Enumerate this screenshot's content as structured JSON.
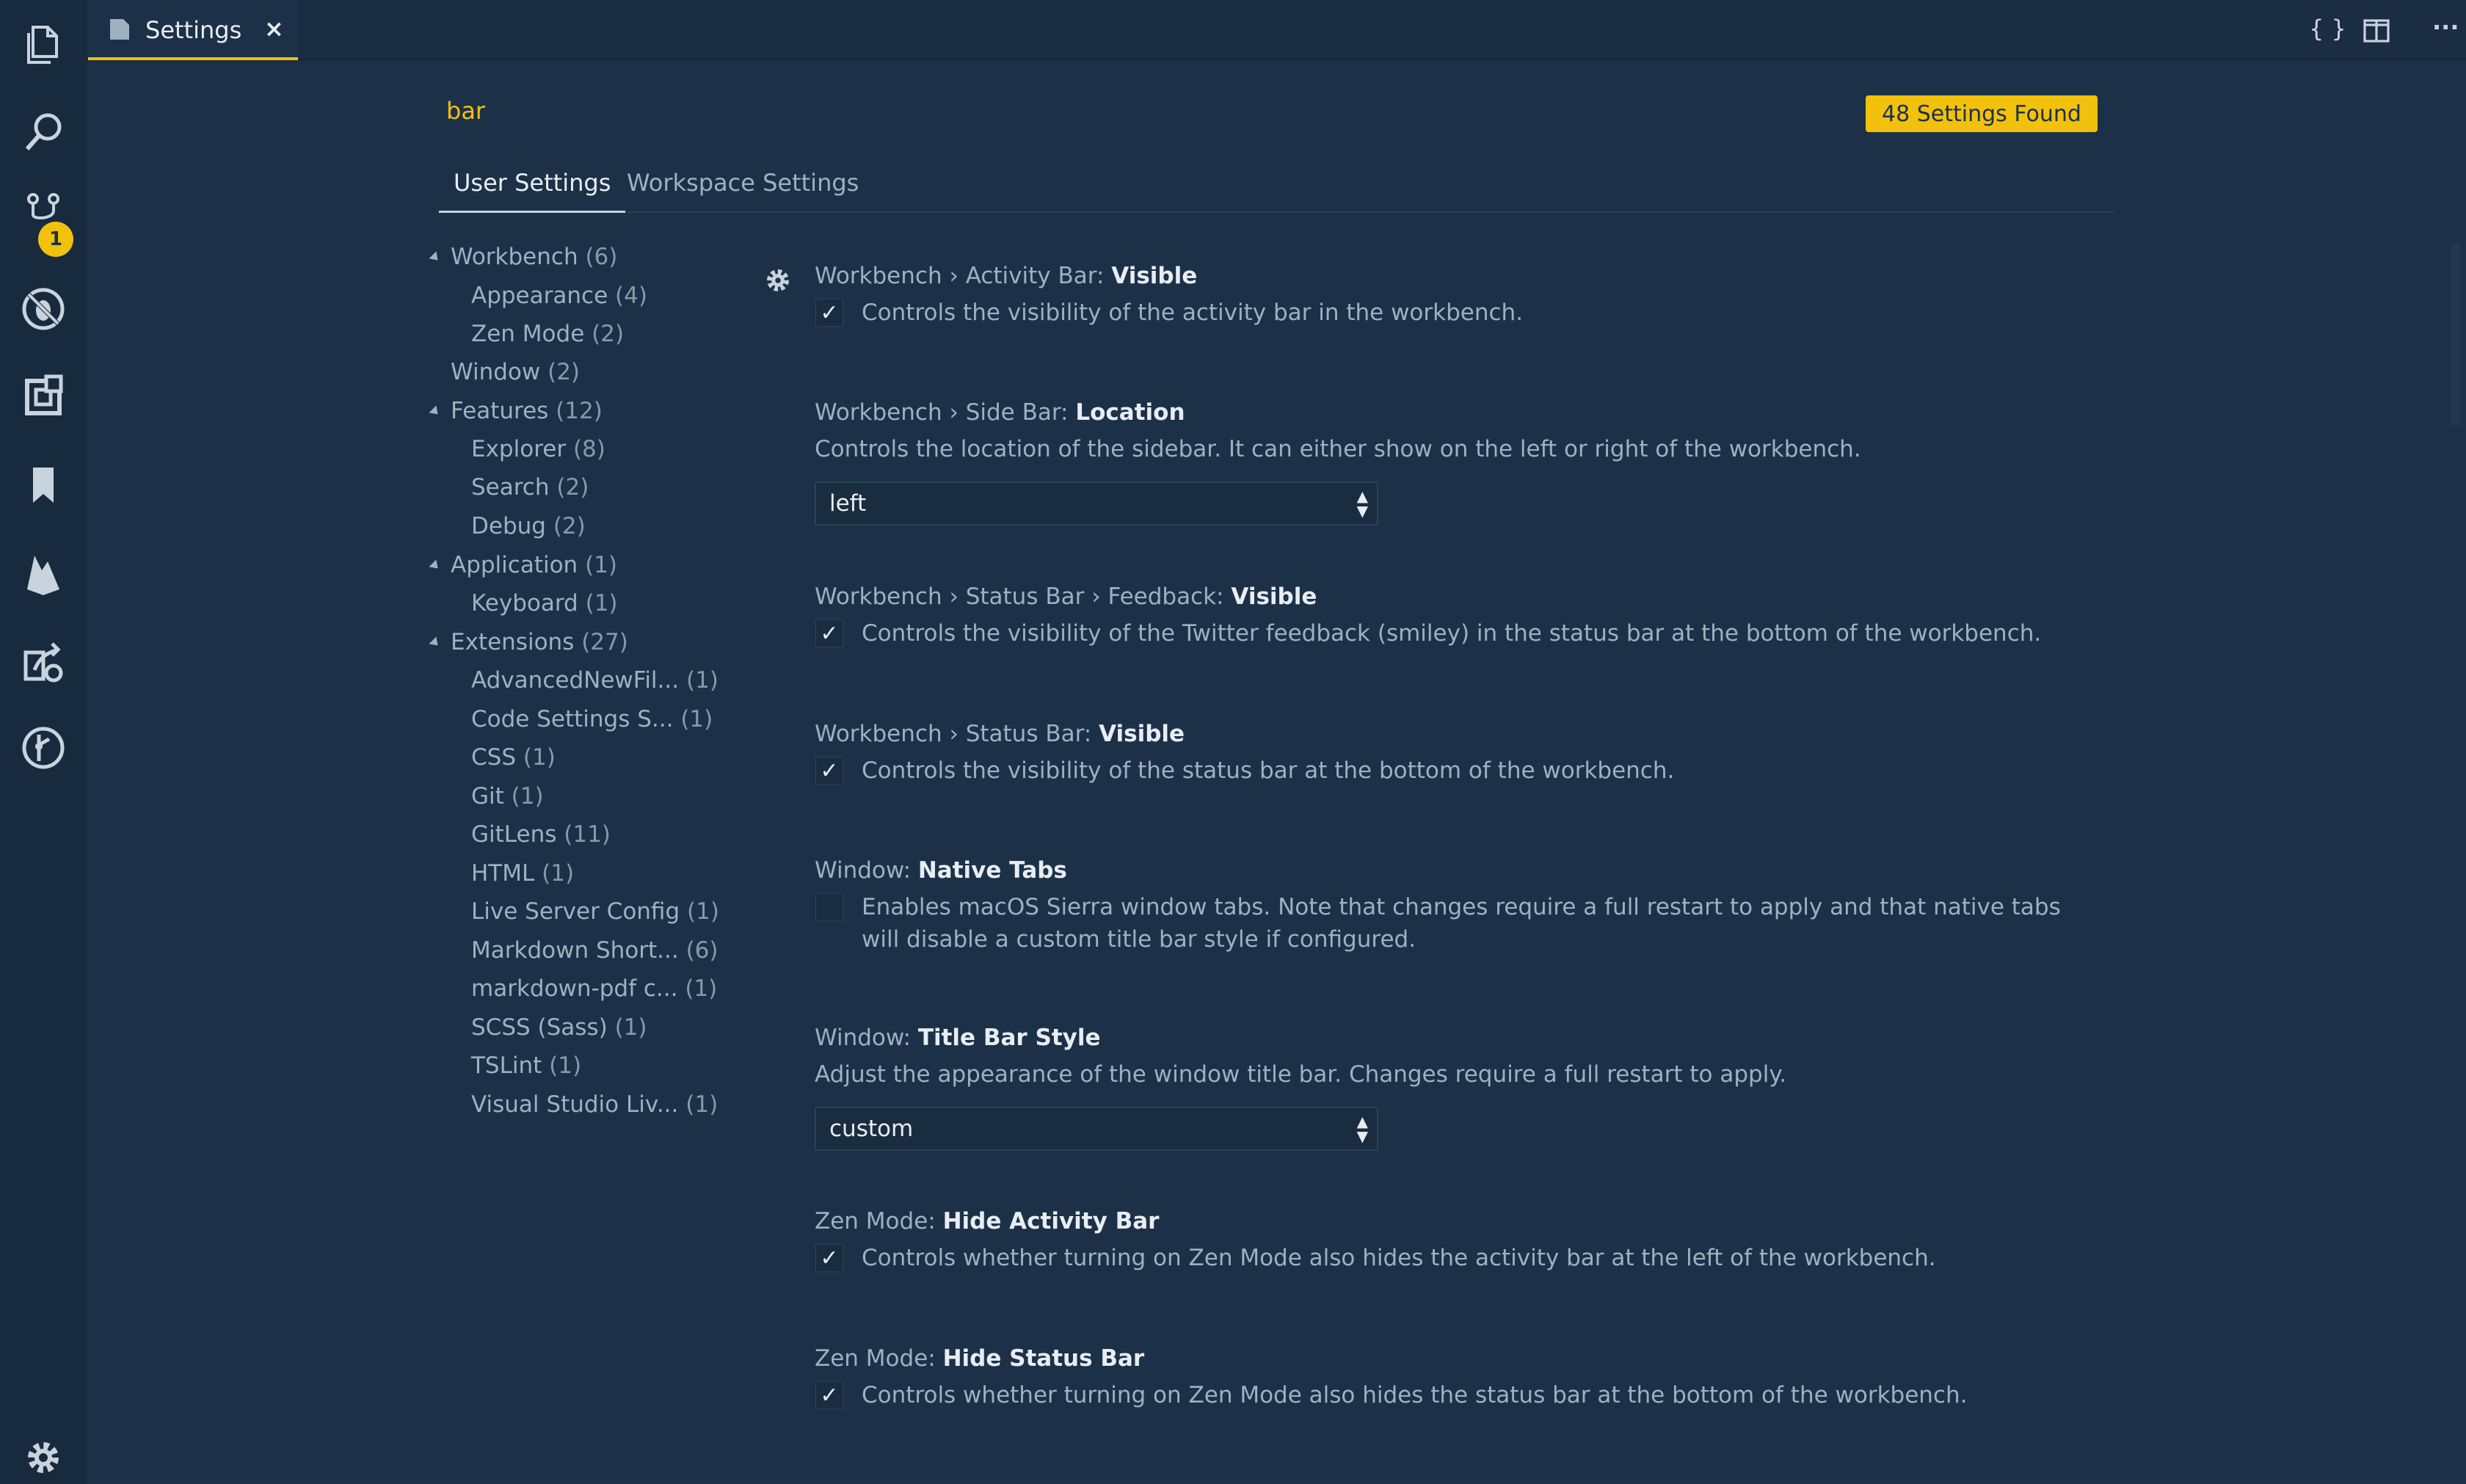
{
  "tab": {
    "label": "Settings",
    "close": "×"
  },
  "toolbar": {
    "braces": "{ }",
    "more": "···"
  },
  "activity": {
    "scm_badge": "1"
  },
  "search": {
    "query": "bar",
    "found": "48 Settings Found"
  },
  "scope_tabs": {
    "user": "User Settings",
    "workspace": "Workspace Settings"
  },
  "toc": [
    {
      "label": "Workbench",
      "count": "(6)"
    },
    {
      "label": "Appearance",
      "count": "(4)"
    },
    {
      "label": "Zen Mode",
      "count": "(2)"
    },
    {
      "label": "Window",
      "count": "(2)"
    },
    {
      "label": "Features",
      "count": "(12)"
    },
    {
      "label": "Explorer",
      "count": "(8)"
    },
    {
      "label": "Search",
      "count": "(2)"
    },
    {
      "label": "Debug",
      "count": "(2)"
    },
    {
      "label": "Application",
      "count": "(1)"
    },
    {
      "label": "Keyboard",
      "count": "(1)"
    },
    {
      "label": "Extensions",
      "count": "(27)"
    },
    {
      "label": "AdvancedNewFil...",
      "count": "(1)"
    },
    {
      "label": "Code Settings S...",
      "count": "(1)"
    },
    {
      "label": "CSS",
      "count": "(1)"
    },
    {
      "label": "Git",
      "count": "(1)"
    },
    {
      "label": "GitLens",
      "count": "(11)"
    },
    {
      "label": "HTML",
      "count": "(1)"
    },
    {
      "label": "Live Server Config",
      "count": "(1)"
    },
    {
      "label": "Markdown Short...",
      "count": "(6)"
    },
    {
      "label": "markdown-pdf c...",
      "count": "(1)"
    },
    {
      "label": "SCSS (Sass)",
      "count": "(1)"
    },
    {
      "label": "TSLint",
      "count": "(1)"
    },
    {
      "label": "Visual Studio Liv...",
      "count": "(1)"
    }
  ],
  "settings": [
    {
      "path": "Workbench › Activity Bar: ",
      "leaf": "Visible",
      "checked": true,
      "desc": "Controls the visibility of the activity bar in the workbench."
    },
    {
      "path": "Workbench › Side Bar: ",
      "leaf": "Location",
      "desc": "Controls the location of the sidebar. It can either show on the left or right of the workbench.",
      "value": "left"
    },
    {
      "path": "Workbench › Status Bar › Feedback: ",
      "leaf": "Visible",
      "checked": true,
      "desc": "Controls the visibility of the Twitter feedback (smiley) in the status bar at the bottom of the workbench."
    },
    {
      "path": "Workbench › Status Bar: ",
      "leaf": "Visible",
      "checked": true,
      "desc": "Controls the visibility of the status bar at the bottom of the workbench."
    },
    {
      "path": "Window: ",
      "leaf": "Native Tabs",
      "checked": false,
      "desc": "Enables macOS Sierra window tabs. Note that changes require a full restart to apply and that native tabs will disable a custom title bar style if configured."
    },
    {
      "path": "Window: ",
      "leaf": "Title Bar Style",
      "desc": "Adjust the appearance of the window title bar. Changes require a full restart to apply.",
      "value": "custom"
    },
    {
      "path": "Zen Mode: ",
      "leaf": "Hide Activity Bar",
      "checked": true,
      "desc": "Controls whether turning on Zen Mode also hides the activity bar at the left of the workbench."
    },
    {
      "path": "Zen Mode: ",
      "leaf": "Hide Status Bar",
      "checked": true,
      "desc": "Controls whether turning on Zen Mode also hides the status bar at the bottom of the workbench."
    }
  ],
  "checkmark": "✓",
  "colors": {
    "accent": "#f2c10c",
    "background": "#1c3148",
    "activity_bar": "#172a3e"
  }
}
